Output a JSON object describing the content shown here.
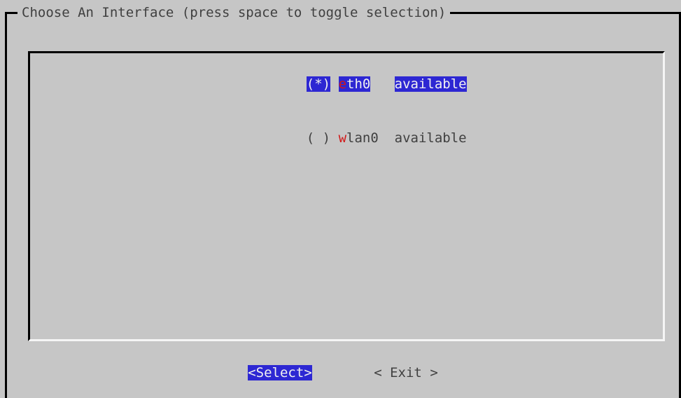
{
  "dialog": {
    "title": "Choose An Interface (press space to toggle selection)"
  },
  "interfaces": {
    "items": [
      {
        "checked_mark": "*",
        "name_first": "e",
        "name_rest": "th0",
        "status": "available",
        "highlighted": true
      },
      {
        "checked_mark": " ",
        "name_first": "w",
        "name_rest": "lan0",
        "status": "available",
        "highlighted": false
      }
    ]
  },
  "buttons": {
    "select": {
      "label": "Select",
      "active": true
    },
    "exit": {
      "label": "Exit",
      "active": false
    }
  },
  "colors": {
    "bg": "#c6c6c6",
    "text": "#404040",
    "highlight_bg": "#2d27d3",
    "highlight_fg": "#f0f0f0",
    "accent_red": "#d11919"
  }
}
